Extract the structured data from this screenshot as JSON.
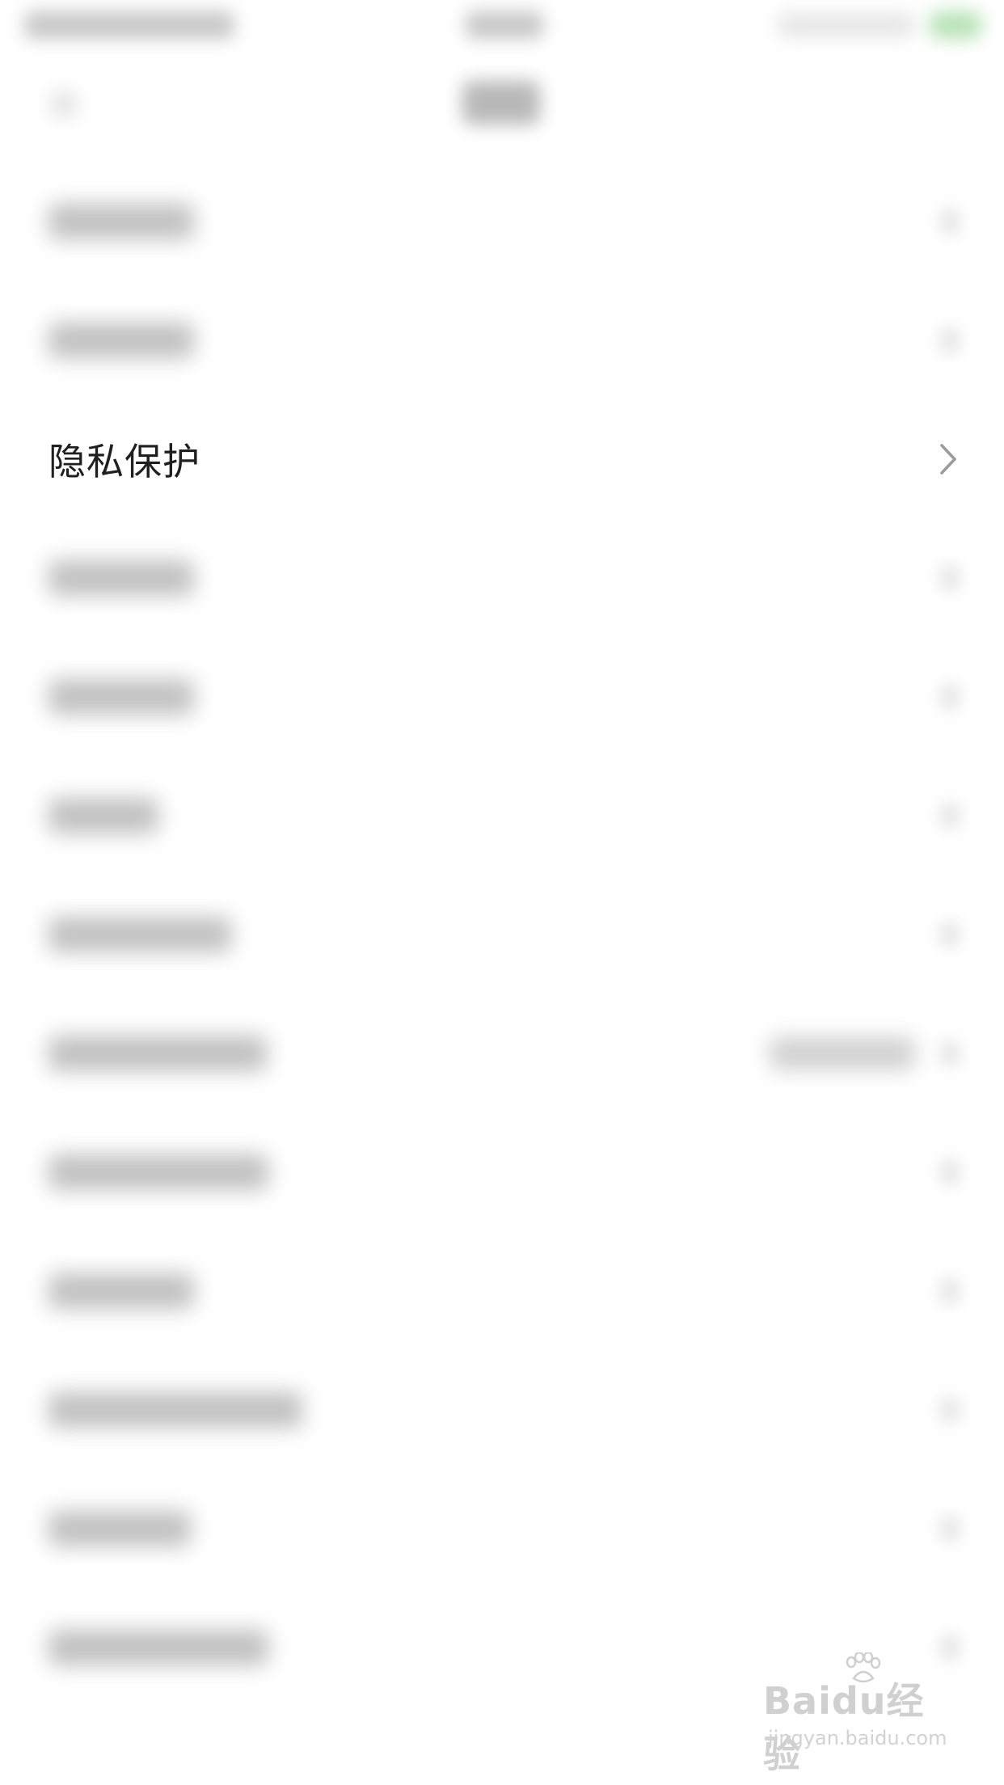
{
  "settings": {
    "items": [
      {
        "label": "",
        "blurred": true
      },
      {
        "label": "",
        "blurred": true
      },
      {
        "label": "隐私保护",
        "blurred": false
      },
      {
        "label": "",
        "blurred": true
      },
      {
        "label": "",
        "blurred": true
      },
      {
        "label": "",
        "blurred": true
      },
      {
        "label": "",
        "blurred": true
      },
      {
        "label": "",
        "blurred": true,
        "has_value": true
      },
      {
        "label": "",
        "blurred": true
      },
      {
        "label": "",
        "blurred": true
      },
      {
        "label": "",
        "blurred": true
      },
      {
        "label": "",
        "blurred": true
      },
      {
        "label": "",
        "blurred": true
      }
    ]
  },
  "watermark": {
    "brand": "Baidu经验",
    "url": "jingyan.baidu.com"
  }
}
